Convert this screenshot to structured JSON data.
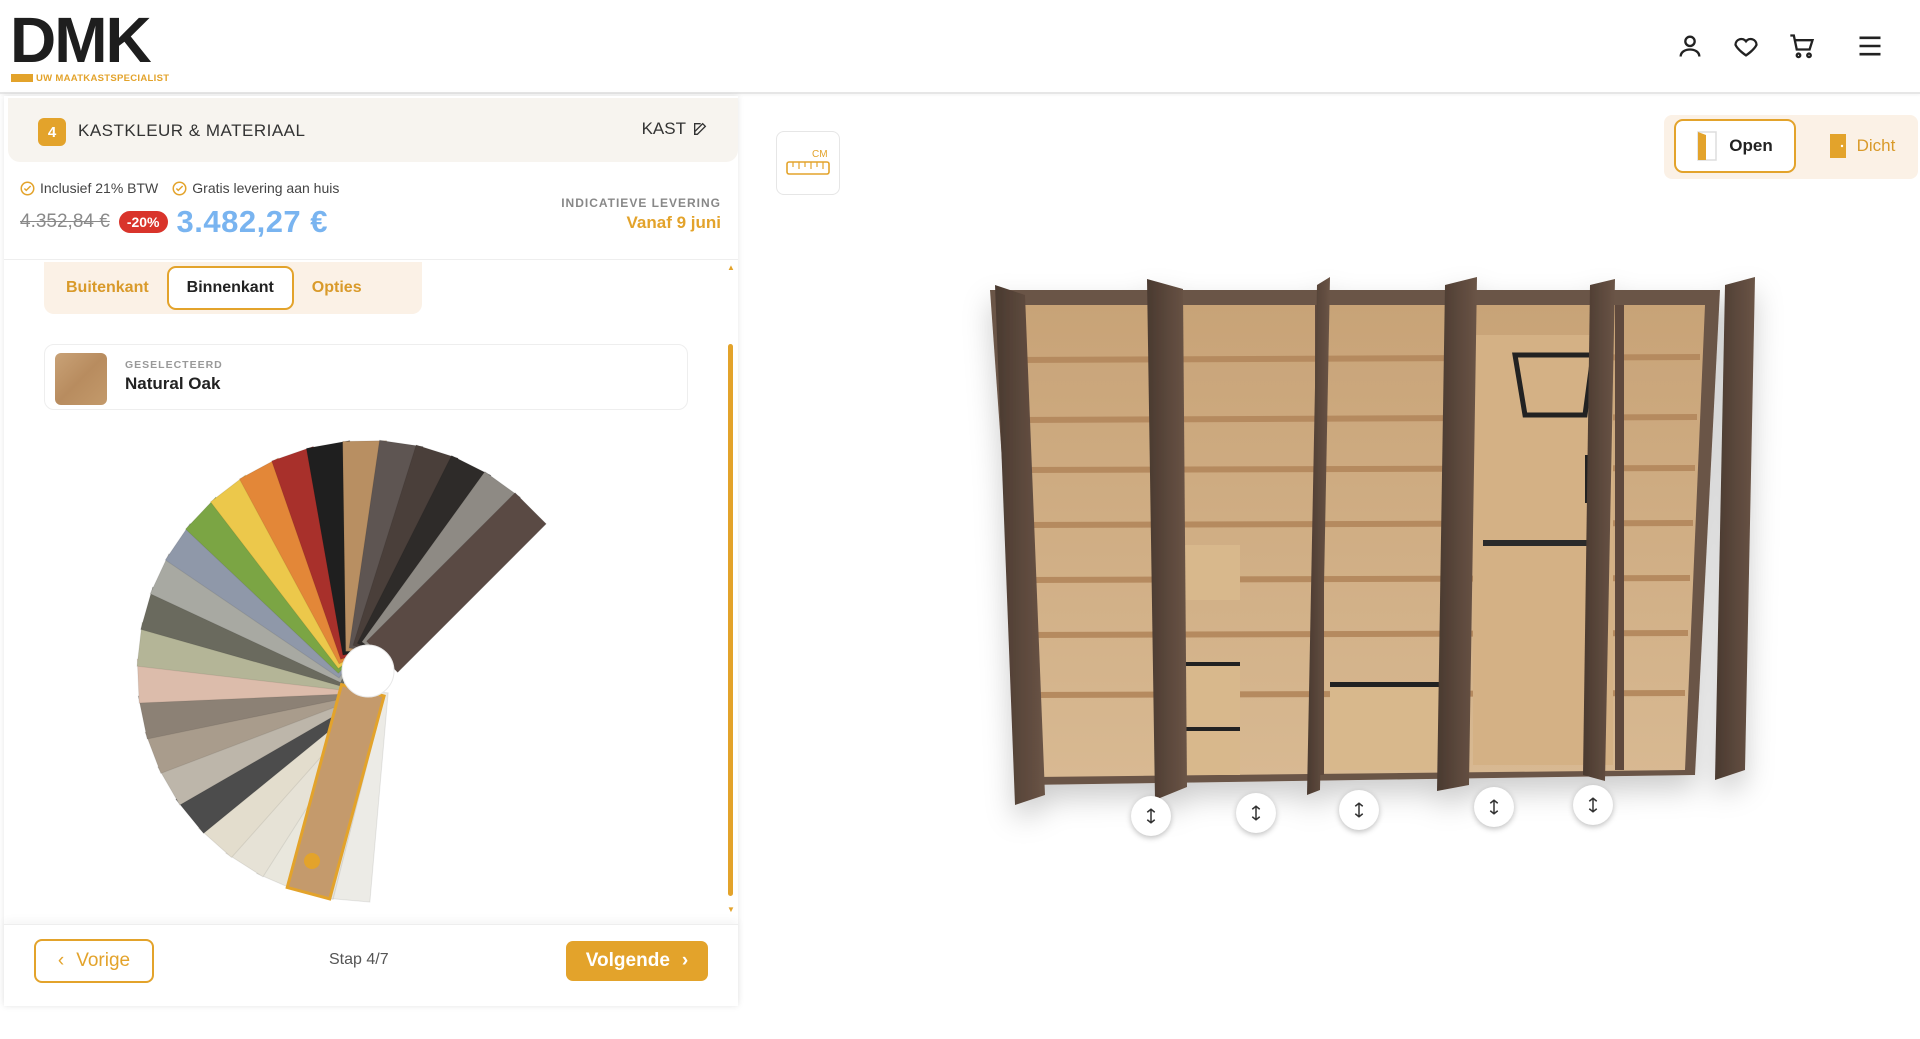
{
  "brand": {
    "logo_text": "DMK",
    "tagline": "UW MAATKASTSPECIALIST",
    "accent_color": "#e3a32b"
  },
  "header": {
    "icons": [
      "user-icon",
      "heart-icon",
      "cart-icon",
      "menu-icon"
    ]
  },
  "step": {
    "number": "4",
    "title": "KASTKLEUR & MATERIAAL",
    "edit_label": "KAST"
  },
  "pricing": {
    "badge_vat": "Inclusief 21% BTW",
    "badge_delivery": "Gratis levering aan huis",
    "old_price": "4.352,84 €",
    "discount": "-20%",
    "new_price": "3.482,27 €",
    "delivery_label": "INDICATIEVE LEVERING",
    "delivery_date": "Vanaf 9 juni"
  },
  "tabs": [
    {
      "label": "Buitenkant",
      "active": false
    },
    {
      "label": "Binnenkant",
      "active": true
    },
    {
      "label": "Opties",
      "active": false
    }
  ],
  "selection": {
    "label": "GESELECTEERD",
    "name": "Natural Oak"
  },
  "swatches": [
    "#ecebe6",
    "#e4e2da",
    "#e9e7dd",
    "#e6e2d6",
    "#e3ddcd",
    "#4c4c4c",
    "#bdb6aa",
    "#a99c8c",
    "#8c8175",
    "#dcbcab",
    "#b4b597",
    "#6a6a5e",
    "#a8a9a2",
    "#8f98a9",
    "#7ba544",
    "#ecc84b",
    "#e38738",
    "#a8302b",
    "#1f1f1f",
    "#b88f62",
    "#5e5552",
    "#4a3f3a",
    "#2e2b29",
    "#8e8a84",
    "#5a4a44"
  ],
  "navigation": {
    "prev_label": "Vorige",
    "step_counter": "Stap 4/7",
    "next_label": "Volgende"
  },
  "viewer": {
    "measure_unit": "CM",
    "open_label": "Open",
    "closed_label": "Dicht"
  }
}
